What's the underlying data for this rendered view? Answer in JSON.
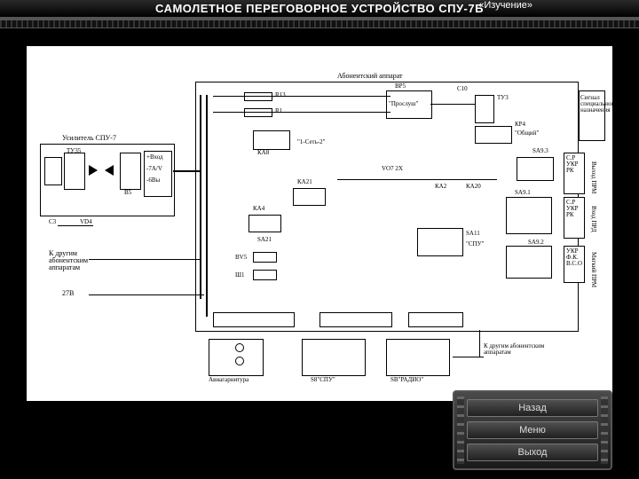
{
  "header": {
    "tag": "«Изучение»",
    "title": "САМОЛЕТНОЕ ПЕРЕГОВОРНОЕ УСТРОЙСТВО СПУ-7Б"
  },
  "labels": {
    "subscriber_unit": "Абонентский аппарат",
    "amplifier": "Усилитель СПУ-7",
    "tv35": "ТУ35",
    "vd4": "VD4",
    "c3": "C3",
    "b5": "В5",
    "r13": "R13",
    "r1": "R1",
    "ka8": "КА8",
    "net12": "\"1-Сеть-2\"",
    "bp5": "ВР5",
    "proslush": "\"Прослуш\"",
    "c10": "C10",
    "tv3": "ТУ3",
    "kp4": "КР4",
    "obshch": "\"Общий\"",
    "sa93": "SA9.3",
    "signal": "Сигнал специального назначения",
    "ka21": "КА21",
    "ka4": "КА4",
    "sa21": "SA21",
    "bv5": "ВV5",
    "sh1": "Ш1",
    "ka2": "КА2",
    "ka20": "КА20",
    "vo7": "VО7 2Х",
    "sa91": "SA9.1",
    "sa11": "SA11",
    "spu": "\"СПУ\"",
    "sa92": "SA9.2",
    "to_other1": "К другим абонентским аппаратам",
    "to_other2": "К другим абонентским аппаратам",
    "v27": "27В",
    "headset": "Авиагарнитура",
    "s8": "S8\"СПУ\"",
    "sb_radio": "SВ\"РАДИО\"",
    "prm_out": "Выход ПРМ",
    "prd_in": "Вход ПРД",
    "prm_soft": "Мягкий ПРМ",
    "cp_ukr_pk": "С.Р\nУКР\nРК",
    "ukr_fk_vso": "УКР\nФ.К.\nВ.С.О",
    "plus27": "+Вход",
    "amp_out1": "-7A/V",
    "amp_out2": "-6Вы"
  },
  "nav": {
    "btn1": "Назад",
    "btn2": "Меню",
    "btn3": "Выход"
  }
}
